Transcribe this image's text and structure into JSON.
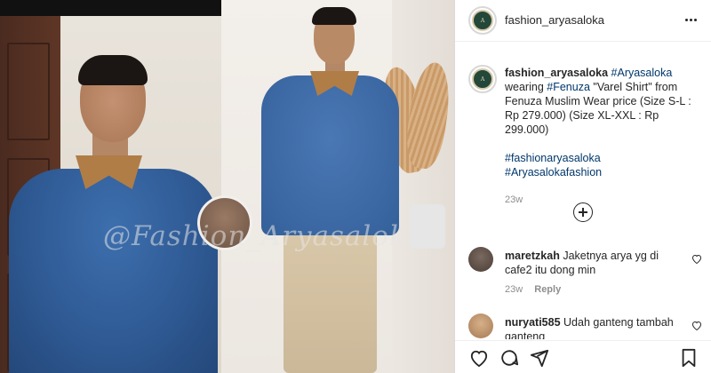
{
  "post": {
    "username": "fashion_aryasaloka",
    "more_icon": "more-horizontal-icon"
  },
  "watermark": {
    "text": "@Fashion_Aryasaloka"
  },
  "caption": {
    "username": "fashion_aryasaloka",
    "tag_main": "#Aryasaloka",
    "text_wearing": " wearing ",
    "tag_product": "#Fenuza",
    "text_body": " \"Varel Shirt\" from Fenuza Muslim Wear price (Size S-L : Rp 279.000) (Size XL-XXL : Rp 299.000)",
    "hashtag_1": "#fashionaryasaloka",
    "hashtag_2": "#Aryasalokafashion",
    "time": "23w"
  },
  "load_more_icon": "plus-circle-icon",
  "comments": [
    {
      "username": "maretzkah",
      "text": "Jaketnya arya yg di cafe2 itu dong min",
      "time": "23w",
      "reply_label": "Reply"
    },
    {
      "username": "nuryati585",
      "text": "Udah ganteng tambah ganteng"
    }
  ],
  "actions": {
    "like_icon": "heart-icon",
    "comment_icon": "comment-icon",
    "share_icon": "send-icon",
    "save_icon": "bookmark-icon"
  },
  "colors": {
    "link": "#00376b",
    "text": "#262626",
    "muted": "#8e8e8e",
    "border": "#dbdbdb"
  }
}
